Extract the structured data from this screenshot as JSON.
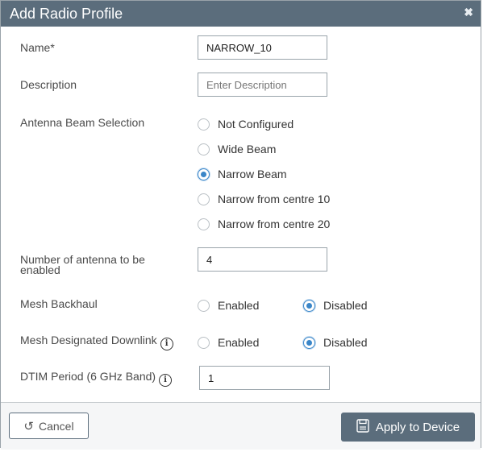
{
  "dialog": {
    "title": "Add Radio Profile",
    "close_icon": "close-icon"
  },
  "form": {
    "name": {
      "label": "Name*",
      "value": "NARROW_10"
    },
    "description": {
      "label": "Description",
      "placeholder": "Enter Description",
      "value": ""
    },
    "antenna_beam": {
      "label": "Antenna Beam Selection",
      "options": [
        "Not Configured",
        "Wide Beam",
        "Narrow Beam",
        "Narrow from centre 10",
        "Narrow from centre 20"
      ],
      "selected": "Narrow Beam"
    },
    "num_antenna": {
      "label": "Number of antenna to be enabled",
      "value": "4"
    },
    "mesh_backhaul": {
      "label": "Mesh Backhaul",
      "options": [
        "Enabled",
        "Disabled"
      ],
      "selected": "Disabled"
    },
    "mesh_downlink": {
      "label": "Mesh Designated Downlink",
      "info_icon": "info-icon",
      "options": [
        "Enabled",
        "Disabled"
      ],
      "selected": "Disabled"
    },
    "dtim": {
      "label": "DTIM Period (6 GHz Band)",
      "info_icon": "info-icon",
      "value": "1"
    }
  },
  "footer": {
    "cancel_label": "Cancel",
    "apply_label": "Apply to Device"
  },
  "colors": {
    "titlebar": "#5b6d7c",
    "radio_selected": "#3a86c8"
  }
}
